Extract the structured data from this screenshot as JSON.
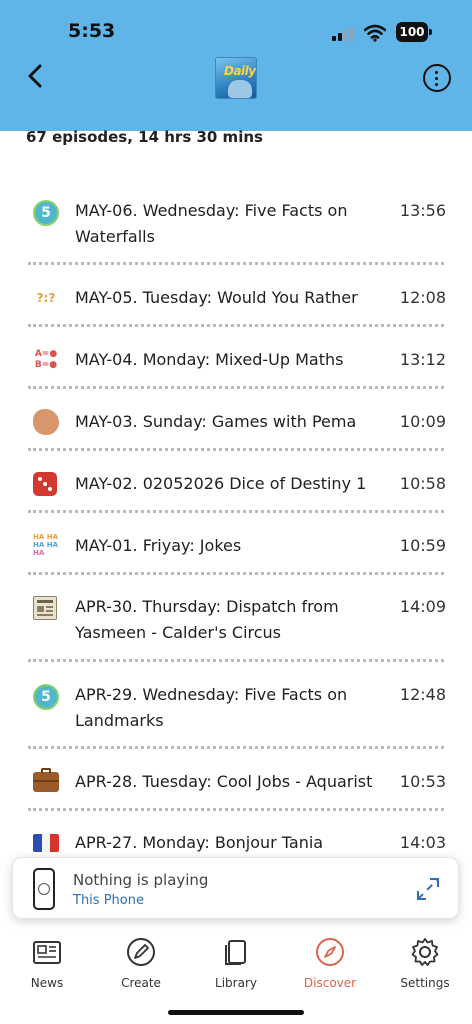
{
  "status_bar": {
    "time": "5:53",
    "battery": "100"
  },
  "header": {
    "podcast_title": "Daily"
  },
  "summary": "67 episodes, 14 hrs 30 mins",
  "episodes": [
    {
      "icon": "number-5-badge-icon",
      "title": "MAY-06. Wednesday: Five Facts on Waterfalls",
      "duration": "13:56"
    },
    {
      "icon": "question-marks-icon",
      "title": "MAY-05. Tuesday: Would You Rather",
      "duration": "12:08"
    },
    {
      "icon": "math-symbols-icon",
      "title": "MAY-04. Monday: Mixed-Up Maths",
      "duration": "13:12"
    },
    {
      "icon": "clapping-hands-icon",
      "title": "MAY-03. Sunday: Games with Pema",
      "duration": "10:09"
    },
    {
      "icon": "dice-icon",
      "title": "MAY-02. 02052026 Dice of Destiny 1",
      "duration": "10:58"
    },
    {
      "icon": "ha-ha-laugh-icon",
      "title": "MAY-01. Friyay: Jokes",
      "duration": "10:59"
    },
    {
      "icon": "newspaper-icon",
      "title": "APR-30. Thursday: Dispatch from Yasmeen - Calder's Circus",
      "duration": "14:09"
    },
    {
      "icon": "number-5-badge-icon",
      "title": "APR-29. Wednesday: Five Facts on Landmarks",
      "duration": "12:48"
    },
    {
      "icon": "briefcase-icon",
      "title": "APR-28. Tuesday: Cool Jobs - Aquarist",
      "duration": "10:53"
    },
    {
      "icon": "french-flag-icon",
      "title": "APR-27. Monday: Bonjour Tania",
      "duration": "14:03"
    }
  ],
  "player": {
    "status": "Nothing is playing",
    "device": "This Phone"
  },
  "tabs": [
    {
      "label": "News",
      "icon": "newspaper-icon"
    },
    {
      "label": "Create",
      "icon": "pencil-icon"
    },
    {
      "label": "Library",
      "icon": "library-icon"
    },
    {
      "label": "Discover",
      "icon": "compass-icon",
      "active": true
    },
    {
      "label": "Settings",
      "icon": "gear-icon"
    }
  ],
  "colors": {
    "header_bg": "#5fb4e8",
    "active_tab": "#e0624a",
    "device_link": "#2f6fb5"
  }
}
